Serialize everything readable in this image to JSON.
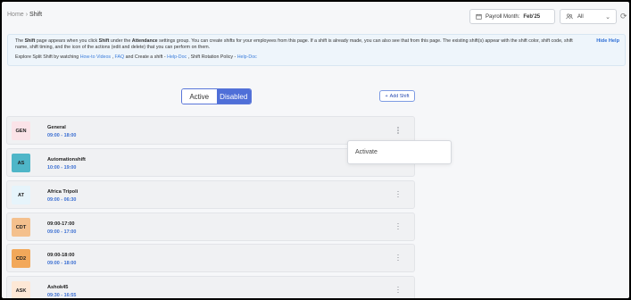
{
  "breadcrumb": {
    "home": "Home",
    "sep": "›",
    "current": "Shift"
  },
  "payroll": {
    "label": "Payroll Month:",
    "value": "Feb'25"
  },
  "group_select": {
    "value": "All"
  },
  "help": {
    "p1_a": "The ",
    "p1_b": "Shift",
    "p1_c": " page appears when you click ",
    "p1_d": "Shift",
    "p1_e": " under the ",
    "p1_f": "Attendance",
    "p1_g": " settings group. You can create shifts for your employees from this page. If a shift is already made, you can also see that from this page. The existing shift(s) appear with the shift color, shift code, shift name, shift timing, and the icon of the actions (edit and delete) that you can perform on them.",
    "hide": "Hide Help",
    "p2_a": "Explore Split Shift by watching ",
    "p2_link1": "How-to Videos",
    "p2_b": " , ",
    "p2_link2": "FAQ",
    "p2_c": " and Create a shift - ",
    "p2_link3": "Help-Doc",
    "p2_d": " , Shift Rotation Policy - ",
    "p2_link4": "Help-Doc"
  },
  "toggle": {
    "active": "Active",
    "disabled": "Disabled"
  },
  "add_shift": {
    "label": "Add Shift"
  },
  "shifts": [
    {
      "code": "GEN",
      "name": "General",
      "time": "09:00 - 18:00",
      "color": "#fbe3e8",
      "text_color": "#222"
    },
    {
      "code": "AS",
      "name": "Automationshift",
      "time": "10:00 - 19:00",
      "color": "#4fb6c8",
      "text_color": "#222"
    },
    {
      "code": "AT",
      "name": "Africa Tripoli",
      "time": "09:00 - 06:30",
      "color": "#e6f4fb",
      "text_color": "#222"
    },
    {
      "code": "CDT",
      "name": "09:00-17:00",
      "time": "09:00 - 17:00",
      "color": "#f4c08d",
      "text_color": "#222"
    },
    {
      "code": "CD2",
      "name": "09:00-18:00",
      "time": "09:00 - 18:00",
      "color": "#f2a85a",
      "text_color": "#222"
    },
    {
      "code": "ASK",
      "name": "Ashok45",
      "time": "09:30 - 16:55",
      "color": "#fde8d6",
      "text_color": "#222"
    }
  ],
  "popup": {
    "label": "Activate"
  },
  "icons": {
    "calendar": "calendar-icon",
    "users": "users-icon",
    "refresh": "refresh-icon",
    "plus": "plus-icon",
    "kebab": "kebab-menu-icon"
  }
}
